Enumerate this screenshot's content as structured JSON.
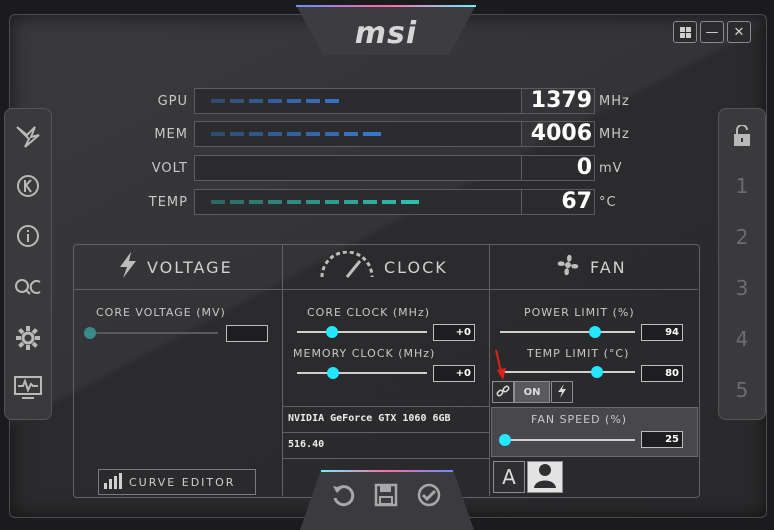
{
  "app": {
    "logo": "msi"
  },
  "window_controls": {
    "windows_icon": "windows-icon",
    "minimize": "—",
    "close": "✕"
  },
  "left_sidebar": {
    "items": [
      {
        "name": "msi-dragon-icon",
        "glyph": "⚔"
      },
      {
        "name": "k-boost-icon",
        "glyph": "Ⓚ"
      },
      {
        "name": "info-icon",
        "glyph": "ⓘ"
      },
      {
        "name": "oc-scanner-icon",
        "glyph": "OC"
      },
      {
        "name": "settings-gear-icon",
        "glyph": "⚙"
      },
      {
        "name": "monitor-icon",
        "glyph": "🖵"
      }
    ]
  },
  "right_sidebar": {
    "lock_glyph": "🔓",
    "profiles": [
      "1",
      "2",
      "3",
      "4",
      "5"
    ]
  },
  "monitors": [
    {
      "label": "GPU",
      "value": "1379",
      "unit": "MHz",
      "level": 0.45,
      "color": "#3a7bd5"
    },
    {
      "label": "MEM",
      "value": "4006",
      "unit": "MHz",
      "level": 0.55,
      "color": "#3a7bd5"
    },
    {
      "label": "VOLT",
      "value": "0",
      "unit": "mV",
      "level": 0.0,
      "color": "#3a7bd5"
    },
    {
      "label": "TEMP",
      "value": "67",
      "unit": "°C",
      "level": 0.67,
      "color": "#2dc6b9"
    }
  ],
  "voltage": {
    "title": "VOLTAGE",
    "core_voltage_label": "CORE VOLTAGE  (MV)",
    "core_voltage_value": "",
    "level": 0.0
  },
  "clock": {
    "title": "CLOCK",
    "core_clock_label": "CORE CLOCK (MHz)",
    "core_clock_value": "+0",
    "core_level": 0.27,
    "memory_clock_label": "MEMORY CLOCK (MHz)",
    "memory_clock_value": "+0",
    "memory_level": 0.28,
    "gpu_name": "NVIDIA GeForce GTX 1060 6GB",
    "driver": "516.40"
  },
  "fan": {
    "title": "FAN",
    "power_limit_label": "POWER LIMIT (%)",
    "power_limit_value": "94",
    "power_level": 0.7,
    "temp_limit_label": "TEMP LIMIT (°C)",
    "temp_limit_value": "80",
    "temp_level": 0.72,
    "link_toggle": "ON",
    "fan_speed_label": "FAN SPEED (%)",
    "fan_speed_value": "25",
    "fan_level": 0.0
  },
  "curve_editor": {
    "label": "CURVE EDITOR"
  },
  "bottom_actions": {
    "reset": "↺",
    "save": "💾",
    "apply": "✔"
  },
  "profile_buttons": {
    "auto": "A",
    "user": "user-icon"
  },
  "colors": {
    "accent": "#23e6ff",
    "bar_blue": "#3a7bd5",
    "bar_teal": "#2dc6b9",
    "annotation_red": "#e0201b"
  }
}
